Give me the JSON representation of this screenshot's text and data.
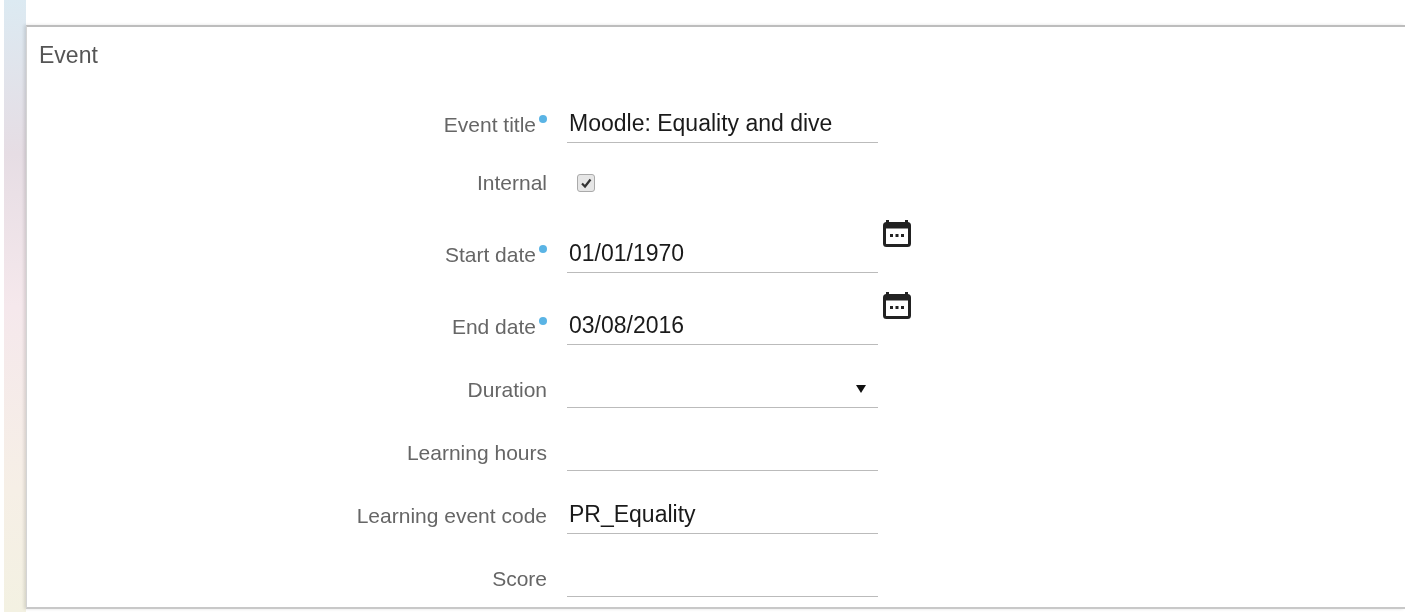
{
  "section": {
    "title": "Event"
  },
  "fields": [
    {
      "kind": "text",
      "label": "Event title",
      "required": true,
      "value": "Moodle: Equality and dive"
    },
    {
      "kind": "checkbox",
      "label": "Internal",
      "required": false,
      "checked": true
    },
    {
      "kind": "date",
      "label": "Start date",
      "required": true,
      "value": "01/01/1970"
    },
    {
      "kind": "date",
      "label": "End date",
      "required": true,
      "value": "03/08/2016"
    },
    {
      "kind": "select",
      "label": "Duration",
      "required": false
    },
    {
      "kind": "text",
      "label": "Learning hours",
      "required": false
    },
    {
      "kind": "text",
      "label": "Learning event code",
      "required": false,
      "value": "PR_Equality"
    },
    {
      "kind": "text",
      "label": "Score",
      "required": false
    }
  ]
}
